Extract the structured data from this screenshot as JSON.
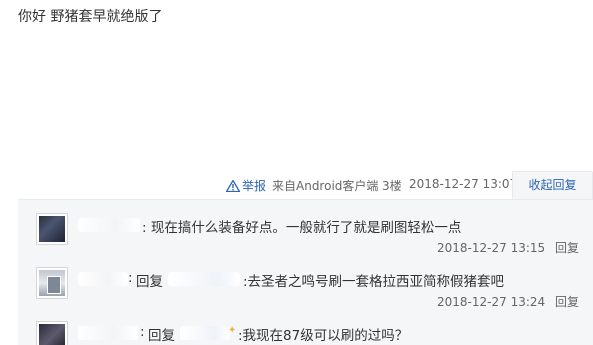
{
  "post": {
    "content": "你好 野猪套早就绝版了"
  },
  "tail": {
    "report_label": "举报",
    "source": "来自Android客户端",
    "floor": "3楼",
    "time": "2018-12-27 13:07",
    "collapse_label": "收起回复"
  },
  "replies": [
    {
      "prefix": ":",
      "text": "现在搞什么装备好点。一般就行了就是刷图轻松一点",
      "time": "2018-12-27 13:15",
      "reply_label": "回复"
    },
    {
      "prefix": ":",
      "reply_word": "回复",
      "text": ":去圣者之鸣号刷一套格拉西亚简称假猪套吧",
      "time": "2018-12-27 13:24",
      "reply_label": "回复"
    },
    {
      "prefix": ":",
      "reply_word": "回复",
      "text": ":我现在87级可以刷的过吗？"
    }
  ],
  "colors": {
    "link": "#2d64b3",
    "reply_bg": "#f5f6f8",
    "meta_text": "#666666"
  },
  "icons": {
    "report": "warning-triangle-icon"
  }
}
